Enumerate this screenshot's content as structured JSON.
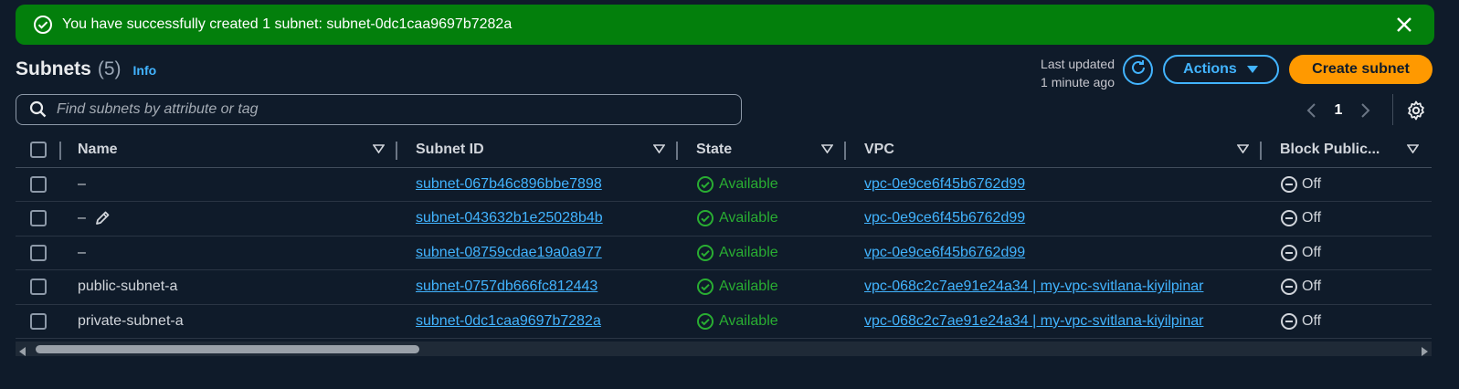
{
  "flash": {
    "message": "You have successfully created 1 subnet: subnet-0dc1caa9697b7282a",
    "color": "#037f0c"
  },
  "header": {
    "title": "Subnets",
    "count": "(5)",
    "info": "Info",
    "last_updated_line1": "Last updated",
    "last_updated_line2": "1 minute ago",
    "actions_label": "Actions",
    "create_label": "Create subnet"
  },
  "search": {
    "placeholder": "Find subnets by attribute or tag",
    "value": ""
  },
  "pagination": {
    "page": "1"
  },
  "table": {
    "columns": [
      "Name",
      "Subnet ID",
      "State",
      "VPC",
      "Block Public..."
    ],
    "rows": [
      {
        "name": "–",
        "subnet_id": "subnet-067b46c896bbe7898",
        "state": "Available",
        "vpc": "vpc-0e9ce6f45b6762d99",
        "block": "Off"
      },
      {
        "name": "–",
        "subnet_id": "subnet-043632b1e25028b4b",
        "state": "Available",
        "vpc": "vpc-0e9ce6f45b6762d99",
        "block": "Off"
      },
      {
        "name": "–",
        "subnet_id": "subnet-08759cdae19a0a977",
        "state": "Available",
        "vpc": "vpc-0e9ce6f45b6762d99",
        "block": "Off"
      },
      {
        "name": "public-subnet-a",
        "subnet_id": "subnet-0757db666fc812443",
        "state": "Available",
        "vpc": "vpc-068c2c7ae91e24a34 | my-vpc-svitlana-kiyilpinar",
        "block": "Off"
      },
      {
        "name": "private-subnet-a",
        "subnet_id": "subnet-0dc1caa9697b7282a",
        "state": "Available",
        "vpc": "vpc-068c2c7ae91e24a34 | my-vpc-svitlana-kiyilpinar",
        "block": "Off"
      }
    ]
  },
  "colors": {
    "background": "#0f1b2a",
    "link": "#42b4ff",
    "primary": "#ff9900",
    "success": "#29ad32"
  },
  "icons": [
    "check-circle-icon",
    "close-icon",
    "refresh-icon",
    "caret-down-icon",
    "search-icon",
    "chevron-left-icon",
    "chevron-right-icon",
    "gear-icon",
    "sort-caret-icon",
    "status-available-icon",
    "status-off-icon",
    "edit-pencil-icon"
  ]
}
